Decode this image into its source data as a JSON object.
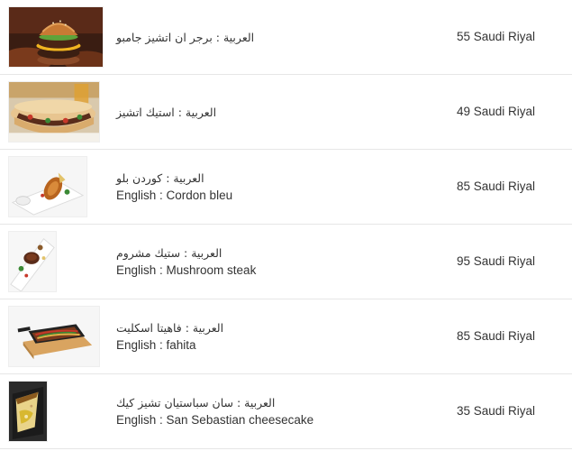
{
  "menu": {
    "items": [
      {
        "name_ar": "العربية : برجر ان اتشيز جامبو",
        "name_en": "",
        "price": "55 Saudi Riyal",
        "image": "burger-photo"
      },
      {
        "name_ar": "العربية : استيك اتشيز",
        "name_en": "",
        "price": "49 Saudi Riyal",
        "image": "steak-sandwich-photo"
      },
      {
        "name_ar": "العربية : كوردن بلو",
        "name_en": "English : Cordon bleu",
        "price": "85 Saudi Riyal",
        "image": "cordon-bleu-photo"
      },
      {
        "name_ar": "العربية : ستيك مشروم",
        "name_en": "English : Mushroom steak",
        "price": "95 Saudi Riyal",
        "image": "mushroom-steak-photo"
      },
      {
        "name_ar": "العربية : فاهيتا اسكليت",
        "name_en": "English : fahita",
        "price": "85 Saudi Riyal",
        "image": "fajita-skillet-photo"
      },
      {
        "name_ar": "العربية : سان سباستيان تشيز كيك",
        "name_en": "English : San Sebastian cheesecake",
        "price": "35 Saudi Riyal",
        "image": "cheesecake-photo"
      }
    ]
  }
}
